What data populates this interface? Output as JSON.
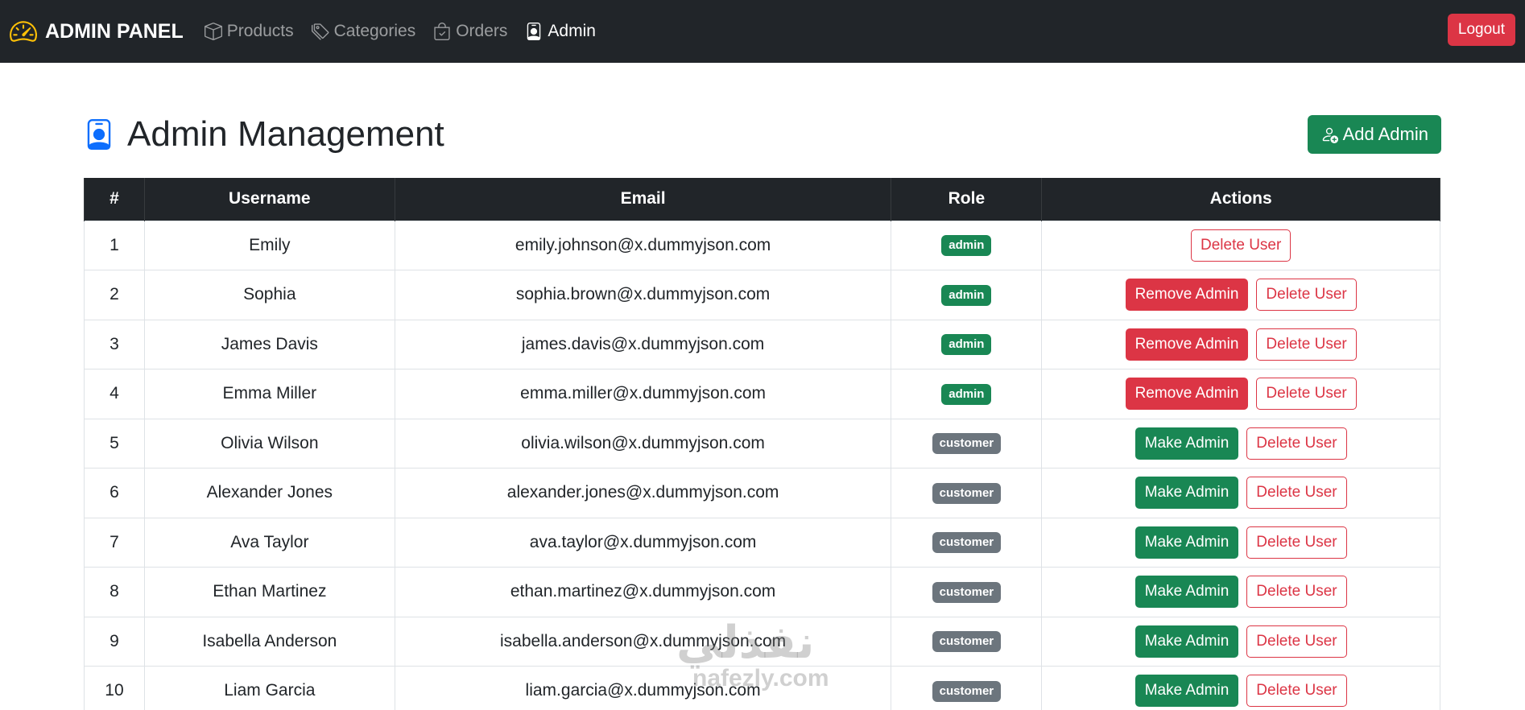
{
  "navbar": {
    "brand": "ADMIN PANEL",
    "links": [
      {
        "label": "Products",
        "icon": "box-icon",
        "active": false
      },
      {
        "label": "Categories",
        "icon": "tags-icon",
        "active": false
      },
      {
        "label": "Orders",
        "icon": "bag-check-icon",
        "active": false
      },
      {
        "label": "Admin",
        "icon": "person-badge-icon",
        "active": true
      }
    ],
    "logout_label": "Logout"
  },
  "header": {
    "title": "Admin Management",
    "add_admin_label": "Add Admin"
  },
  "table": {
    "columns": [
      "#",
      "Username",
      "Email",
      "Role",
      "Actions"
    ],
    "rows": [
      {
        "num": "1",
        "username": "Emily",
        "email": "emily.johnson@x.dummyjson.com",
        "role": "admin",
        "actions": [
          "Delete User"
        ]
      },
      {
        "num": "2",
        "username": "Sophia",
        "email": "sophia.brown@x.dummyjson.com",
        "role": "admin",
        "actions": [
          "Remove Admin",
          "Delete User"
        ]
      },
      {
        "num": "3",
        "username": "James Davis",
        "email": "james.davis@x.dummyjson.com",
        "role": "admin",
        "actions": [
          "Remove Admin",
          "Delete User"
        ]
      },
      {
        "num": "4",
        "username": "Emma Miller",
        "email": "emma.miller@x.dummyjson.com",
        "role": "admin",
        "actions": [
          "Remove Admin",
          "Delete User"
        ]
      },
      {
        "num": "5",
        "username": "Olivia Wilson",
        "email": "olivia.wilson@x.dummyjson.com",
        "role": "customer",
        "actions": [
          "Make Admin",
          "Delete User"
        ]
      },
      {
        "num": "6",
        "username": "Alexander Jones",
        "email": "alexander.jones@x.dummyjson.com",
        "role": "customer",
        "actions": [
          "Make Admin",
          "Delete User"
        ]
      },
      {
        "num": "7",
        "username": "Ava Taylor",
        "email": "ava.taylor@x.dummyjson.com",
        "role": "customer",
        "actions": [
          "Make Admin",
          "Delete User"
        ]
      },
      {
        "num": "8",
        "username": "Ethan Martinez",
        "email": "ethan.martinez@x.dummyjson.com",
        "role": "customer",
        "actions": [
          "Make Admin",
          "Delete User"
        ]
      },
      {
        "num": "9",
        "username": "Isabella Anderson",
        "email": "isabella.anderson@x.dummyjson.com",
        "role": "customer",
        "actions": [
          "Make Admin",
          "Delete User"
        ]
      },
      {
        "num": "10",
        "username": "Liam Garcia",
        "email": "liam.garcia@x.dummyjson.com",
        "role": "customer",
        "actions": [
          "Make Admin",
          "Delete User"
        ]
      }
    ]
  },
  "watermark": {
    "arabic": "نفذلي",
    "latin": "nafezly.com"
  },
  "colors": {
    "navbar_bg": "#212529",
    "danger": "#dc3545",
    "success": "#198754",
    "secondary": "#6c757d",
    "brand_icon": "#ffc107",
    "title_icon": "#0d6efd"
  }
}
